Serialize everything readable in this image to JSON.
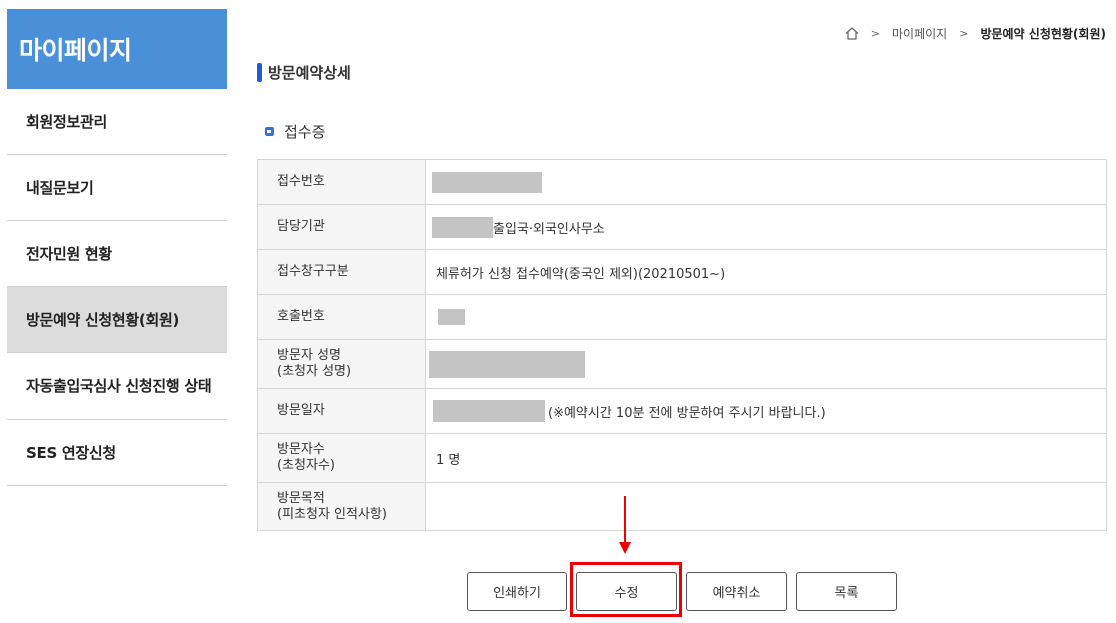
{
  "sidebar": {
    "title": "마이페이지",
    "items": [
      {
        "label": "회원정보관리"
      },
      {
        "label": "내질문보기"
      },
      {
        "label": "전자민원 현황"
      },
      {
        "label": "방문예약 신청현황(회원)"
      },
      {
        "label": "자동출입국심사 신청진행 상태"
      },
      {
        "label": "SES 연장신청"
      }
    ]
  },
  "breadcrumb": {
    "home_icon": "home-icon",
    "items": [
      "마이페이지",
      "방문예약 신청현황(회원)"
    ]
  },
  "page_title": "방문예약상세",
  "section_title": "접수증",
  "table": {
    "rows": [
      {
        "label": "접수번호",
        "value": ""
      },
      {
        "label": "담당기관",
        "value": "출입국·외국인사무소"
      },
      {
        "label": "접수창구구분",
        "value": "체류허가 신청 접수예약(중국인 제외)(20210501~)"
      },
      {
        "label": "호출번호",
        "value": ""
      },
      {
        "label1": "방문자 성명",
        "label2": "(초청자 성명)",
        "value": ""
      },
      {
        "label": "방문일자",
        "value": "(※예약시간 10분 전에 방문하여 주시기 바랍니다.)"
      },
      {
        "label1": "방문자수",
        "label2": "(초청자수)",
        "value": "1 명"
      },
      {
        "label1": "방문목적",
        "label2": "(피초청자 인적사항)",
        "value": ""
      }
    ]
  },
  "buttons": {
    "print": "인쇄하기",
    "edit": "수정",
    "cancel": "예약취소",
    "list": "목록"
  },
  "colors": {
    "sidebar_title_bg": "#4a90d9",
    "active_item_bg": "#dcdcdc",
    "annotation_red": "#e00000"
  }
}
